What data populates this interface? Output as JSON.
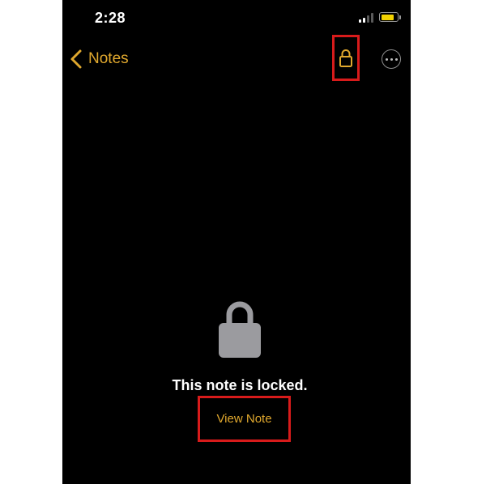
{
  "status_bar": {
    "time": "2:28",
    "signal_bars_active": 2,
    "signal_bars_total": 4,
    "battery_level": 0.85
  },
  "nav": {
    "back_label": "Notes",
    "back_icon": "chevron-left-icon",
    "lock_icon": "lock-icon",
    "more_icon": "ellipsis-circle-icon"
  },
  "content": {
    "lock_icon": "lock-icon",
    "message": "This note is locked.",
    "view_note_label": "View Note"
  },
  "colors": {
    "accent": "#e0a82e",
    "highlight_box": "#d81b1b",
    "lock_gray": "#9b9b9f",
    "battery_fill": "#f2d200",
    "background": "#000000"
  }
}
